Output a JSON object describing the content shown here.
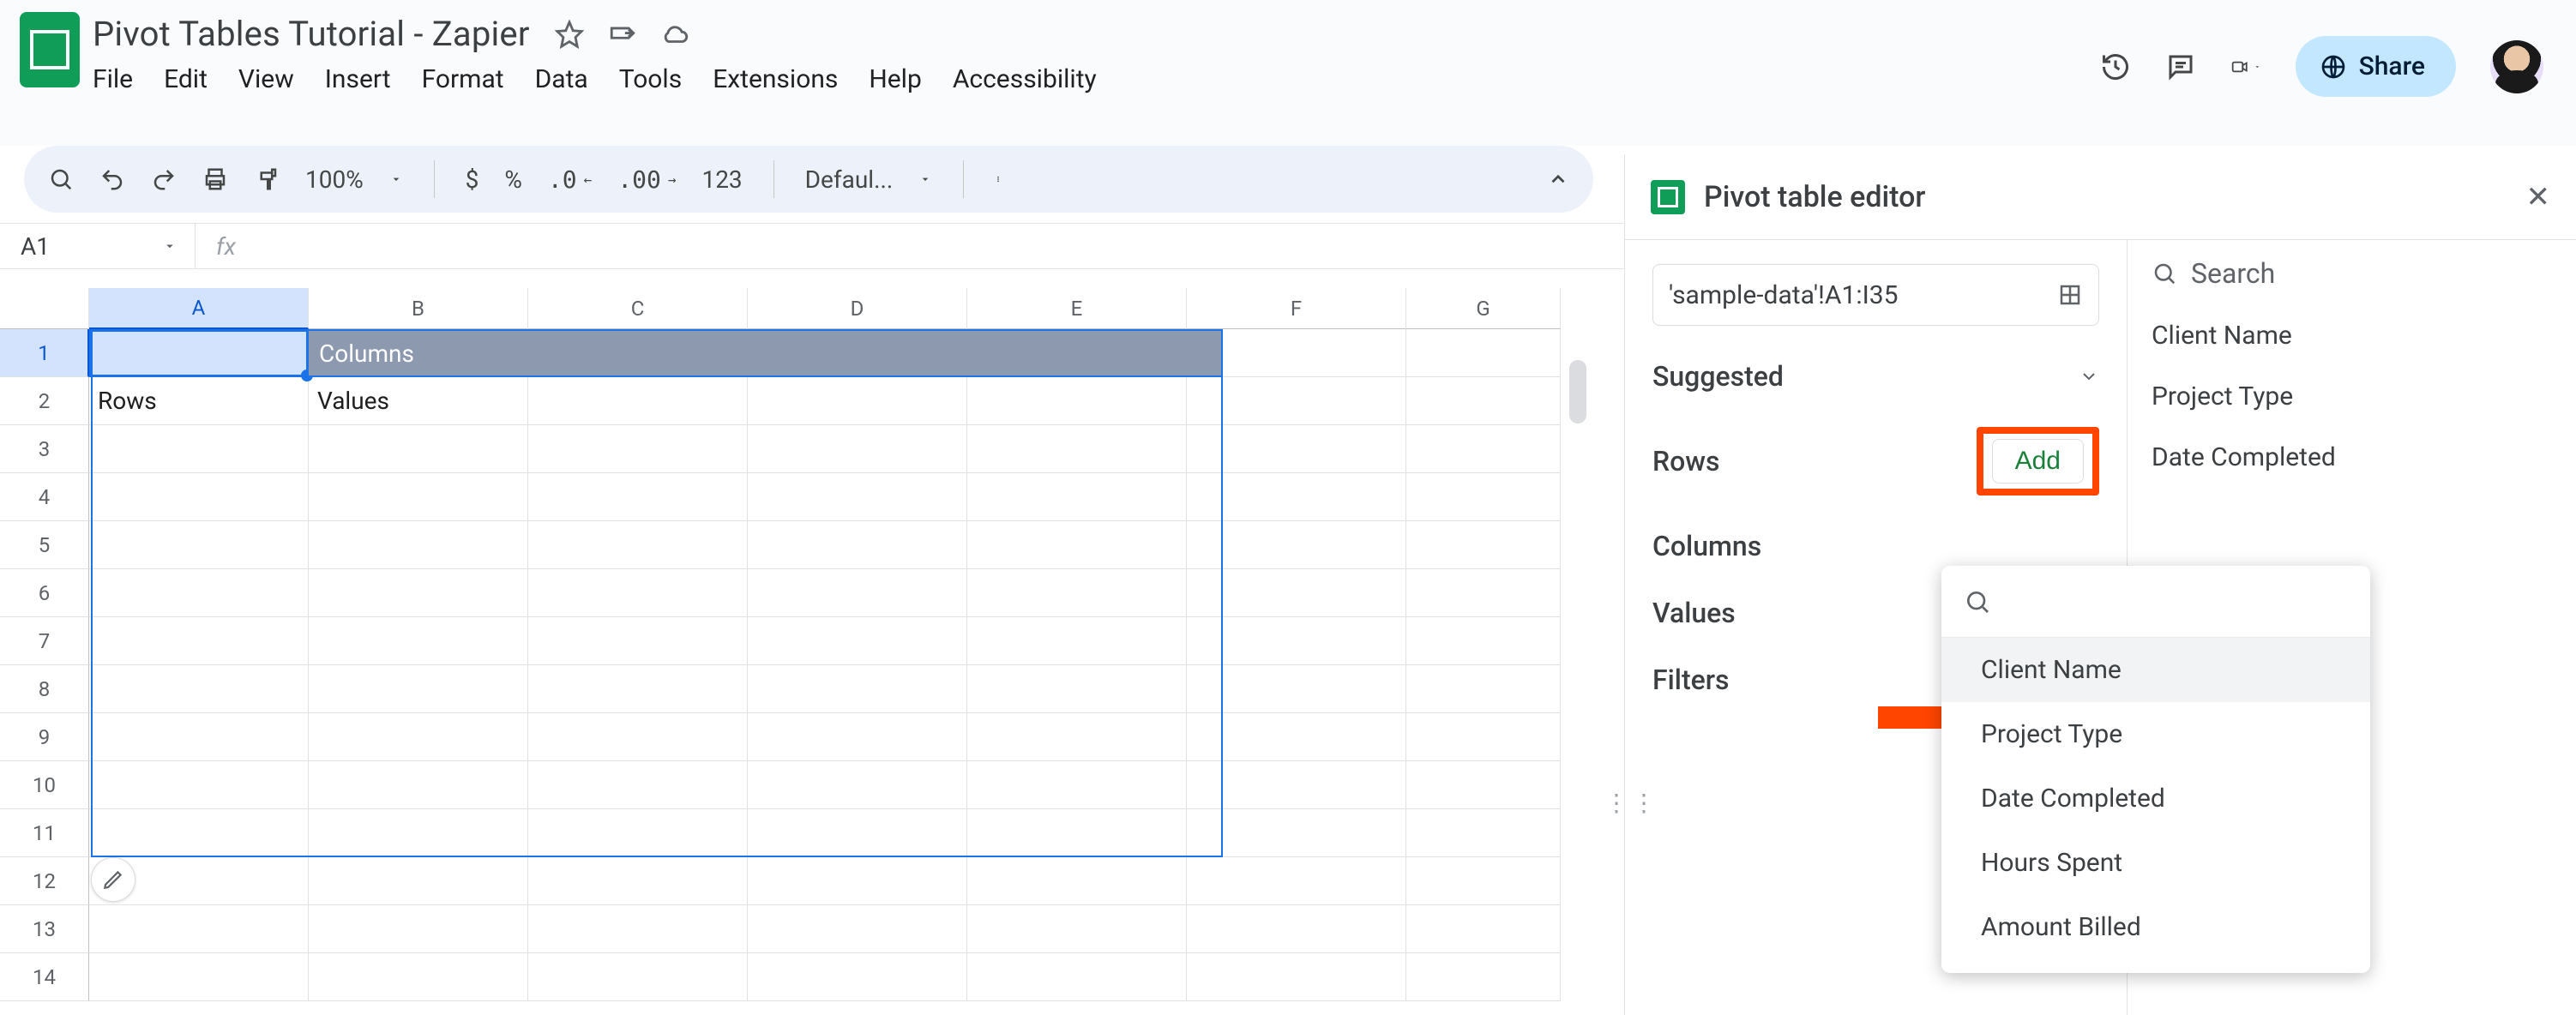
{
  "header": {
    "doc_title": "Pivot Tables Tutorial - Zapier",
    "share_label": "Share"
  },
  "menus": [
    "File",
    "Edit",
    "View",
    "Insert",
    "Format",
    "Data",
    "Tools",
    "Extensions",
    "Help",
    "Accessibility"
  ],
  "toolbar": {
    "zoom": "100%",
    "currency": "$",
    "percent": "%",
    "num123": "123",
    "font": "Defaul..."
  },
  "name_box": "A1",
  "column_headers": [
    "A",
    "B",
    "C",
    "D",
    "E",
    "F",
    "G"
  ],
  "row_headers": [
    "1",
    "2",
    "3",
    "4",
    "5",
    "6",
    "7",
    "8",
    "9",
    "10",
    "11",
    "12",
    "13",
    "14"
  ],
  "pivot_stub": {
    "columns_label": "Columns",
    "rows_label": "Rows",
    "values_label": "Values"
  },
  "panel": {
    "title": "Pivot table editor",
    "range": "'sample-data'!A1:I35",
    "sections": {
      "suggested": "Suggested",
      "rows": "Rows",
      "columns": "Columns",
      "values": "Values",
      "filters": "Filters"
    },
    "add_label": "Add",
    "search_placeholder": "Search",
    "fields": [
      "Client Name",
      "Project Type",
      "Date Completed"
    ],
    "dropdown_fields": [
      "Client Name",
      "Project Type",
      "Date Completed",
      "Hours Spent",
      "Amount Billed"
    ]
  }
}
